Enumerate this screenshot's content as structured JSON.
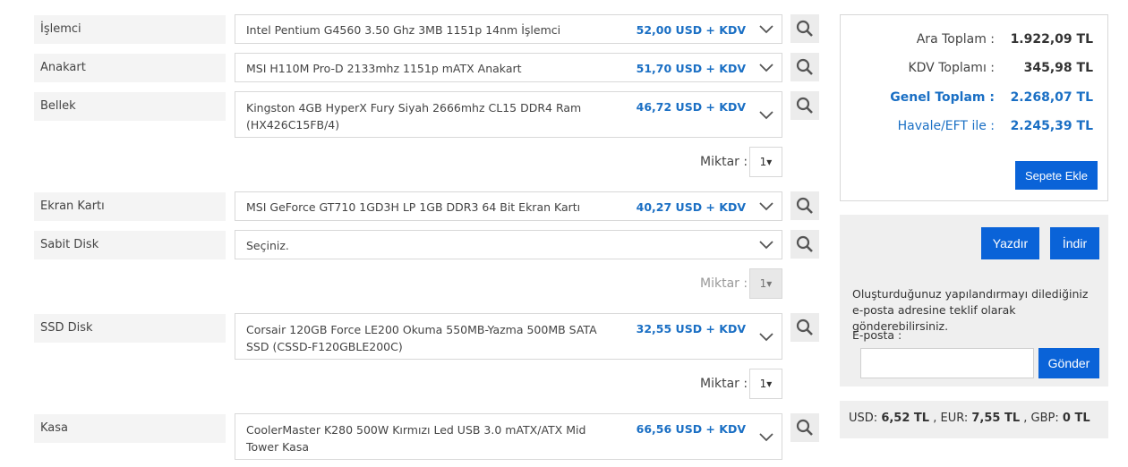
{
  "rows": [
    {
      "label": "İşlemci",
      "product": "Intel Pentium G4560 3.50 Ghz 3MB 1151p 14nm İşlemci",
      "price": "52,00 USD + KDV"
    },
    {
      "label": "Anakart",
      "product": "MSI H110M Pro-D 2133mhz 1151p mATX Anakart",
      "price": "51,70 USD + KDV"
    },
    {
      "label": "Bellek",
      "product": "Kingston 4GB HyperX Fury Siyah 2666mhz CL15 DDR4 Ram (HX426C15FB/4)",
      "price": "46,72 USD + KDV",
      "qty_label": "Miktar :",
      "qty": "1▾"
    },
    {
      "label": "Ekran Kartı",
      "product": "MSI GeForce GT710 1GD3H LP 1GB DDR3 64 Bit Ekran Kartı",
      "price": "40,27 USD + KDV"
    },
    {
      "label": "Sabit Disk",
      "product": "Seçiniz.",
      "price": "",
      "qty_label": "Miktar :",
      "qty": "1▾"
    },
    {
      "label": "SSD Disk",
      "product": "Corsair 120GB Force LE200 Okuma 550MB-Yazma 500MB SATA SSD (CSSD-F120GBLE200C)",
      "price": "32,55 USD + KDV",
      "qty_label": "Miktar :",
      "qty": "1▾"
    },
    {
      "label": "Kasa",
      "product": "CoolerMaster K280 500W Kırmızı Led USB 3.0 mATX/ATX Mid Tower Kasa",
      "price": "66,56 USD + KDV"
    }
  ],
  "summary": {
    "subtotal_label": "Ara Toplam :",
    "subtotal": "1.922,09 TL",
    "vat_label": "KDV Toplamı :",
    "vat": "345,98 TL",
    "total_label": "Genel Toplam :",
    "total": "2.268,07 TL",
    "transfer_label": "Havale/EFT ile :",
    "transfer": "2.245,39 TL",
    "add_to_cart": "Sepete Ekle"
  },
  "actions": {
    "print": "Yazdır",
    "download": "İndir",
    "note": "Oluşturduğunuz yapılandırmayı dilediğiniz e-posta adresine teklif olarak gönderebilirsiniz.",
    "email_label": "E-posta :",
    "email_value": "",
    "send": "Gönder"
  },
  "rates": {
    "usd_label": "USD:",
    "usd": "6,52 TL",
    "eur_label": ", EUR:",
    "eur": "7,55 TL",
    "gbp_label": ", GBP:",
    "gbp": "0 TL"
  },
  "colors": {
    "accent": "#0a63d8",
    "price": "#1a6fc4"
  },
  "icons": {
    "search": "search-icon",
    "chevron": "chevron-down-icon"
  }
}
